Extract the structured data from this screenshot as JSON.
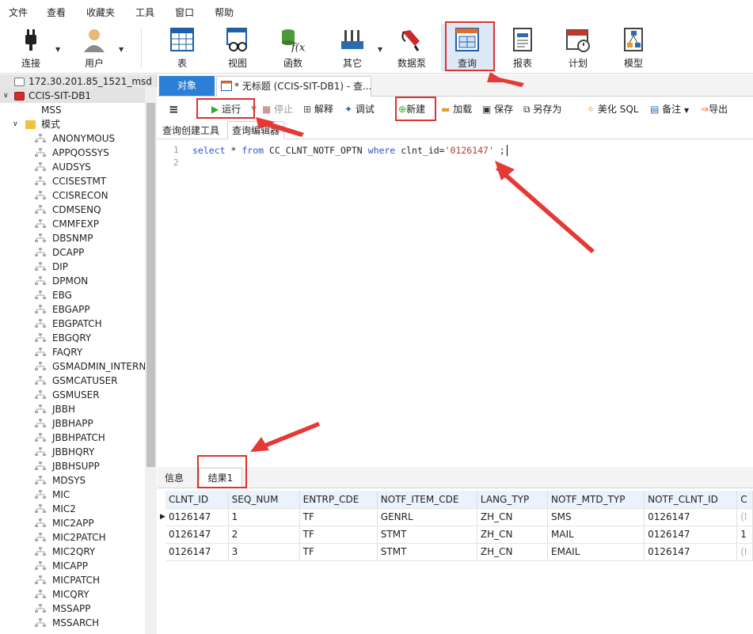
{
  "menu": [
    "文件",
    "查看",
    "收藏夹",
    "工具",
    "窗口",
    "帮助"
  ],
  "toolbar": {
    "connect": "连接",
    "user": "用户",
    "table": "表",
    "view": "视图",
    "function": "函数",
    "other": "其它",
    "datapump": "数据泵",
    "query": "查询",
    "report": "报表",
    "schedule": "计划",
    "model": "模型"
  },
  "tree": {
    "connection": "172.30.201.85_1521_msd",
    "db": "CCIS-SIT-DB1",
    "mss": "MSS",
    "schema": "模式",
    "schemas": [
      "ANONYMOUS",
      "APPQOSSYS",
      "AUDSYS",
      "CCISESTMT",
      "CCISRECON",
      "CDMSENQ",
      "CMMFEXP",
      "DBSNMP",
      "DCAPP",
      "DIP",
      "DPMON",
      "EBG",
      "EBGAPP",
      "EBGPATCH",
      "EBGQRY",
      "FAQRY",
      "GSMADMIN_INTERNAL",
      "GSMCATUSER",
      "GSMUSER",
      "JBBH",
      "JBBHAPP",
      "JBBHPATCH",
      "JBBHQRY",
      "JBBHSUPP",
      "MDSYS",
      "MIC",
      "MIC2",
      "MIC2APP",
      "MIC2PATCH",
      "MIC2QRY",
      "MICAPP",
      "MICPATCH",
      "MICQRY",
      "MSSAPP",
      "MSSARCH"
    ]
  },
  "tabs": {
    "objects": "对象",
    "query_tab": "* 无标题 (CCIS-SIT-DB1) - 查..."
  },
  "editor_toolbar": {
    "run": "运行",
    "stop": "停止",
    "explain": "解释",
    "debug": "调试",
    "new": "新建",
    "load": "加载",
    "save": "保存",
    "saveas": "另存为",
    "beautify": "美化 SQL",
    "comment": "备注",
    "export": "导出"
  },
  "subtabs": {
    "builder": "查询创建工具",
    "editor": "查询编辑器"
  },
  "sql": {
    "line1": "1",
    "line2": "2",
    "kw_select": "select",
    "star": "*",
    "kw_from": "from",
    "table": "CC_CLNT_NOTF_OPTN",
    "kw_where": "where",
    "cond": "clnt_id=",
    "literal": "'0126147'",
    "end": ";"
  },
  "result_tabs": {
    "info": "信息",
    "result1": "结果1"
  },
  "grid": {
    "columns": [
      "CLNT_ID",
      "SEQ_NUM",
      "ENTRP_CDE",
      "NOTF_ITEM_CDE",
      "LANG_TYP",
      "NOTF_MTD_TYP",
      "NOTF_CLNT_ID",
      "C"
    ],
    "rows": [
      [
        "0126147",
        "1",
        "TF",
        "GENRL",
        "ZH_CN",
        "SMS",
        "0126147",
        "(I"
      ],
      [
        "0126147",
        "2",
        "TF",
        "STMT",
        "ZH_CN",
        "MAIL",
        "0126147",
        "1"
      ],
      [
        "0126147",
        "3",
        "TF",
        "STMT",
        "ZH_CN",
        "EMAIL",
        "0126147",
        "(I"
      ]
    ]
  },
  "colors": {
    "accent": "#2c7fd6",
    "highlight": "#e03030",
    "keyword": "#2f55c8",
    "string": "#c0392b"
  }
}
